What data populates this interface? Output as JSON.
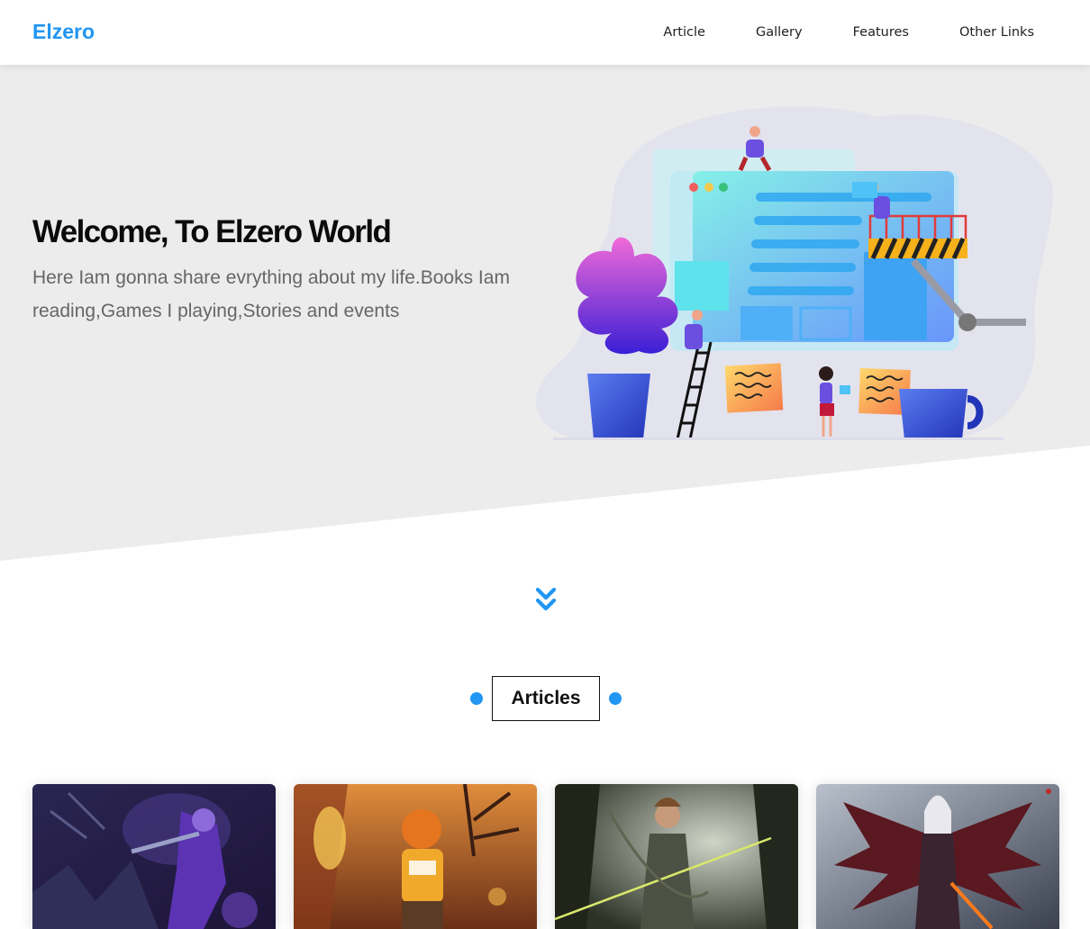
{
  "header": {
    "logo": "Elzero",
    "nav": [
      "Article",
      "Gallery",
      "Features",
      "Other Links"
    ]
  },
  "landing": {
    "title": "Welcome, To Elzero World",
    "text": "Here Iam gonna share evrything about my life.Books Iam reading,Games I playing,Stories and events"
  },
  "articles": {
    "section_title": "Articles",
    "cards": [
      {
        "image": "fantasy-night-elf-warrior-image"
      },
      {
        "image": "cartoon-tiger-character-image"
      },
      {
        "image": "forest-archer-woman-image"
      },
      {
        "image": "winged-dark-angel-image"
      }
    ]
  },
  "colors": {
    "accent": "#2196f3",
    "landing_bg": "#ececec",
    "text_dark": "#0b0b0b",
    "text_muted": "#666666"
  },
  "icons": {
    "go_down": "double-chevron-down-icon"
  }
}
